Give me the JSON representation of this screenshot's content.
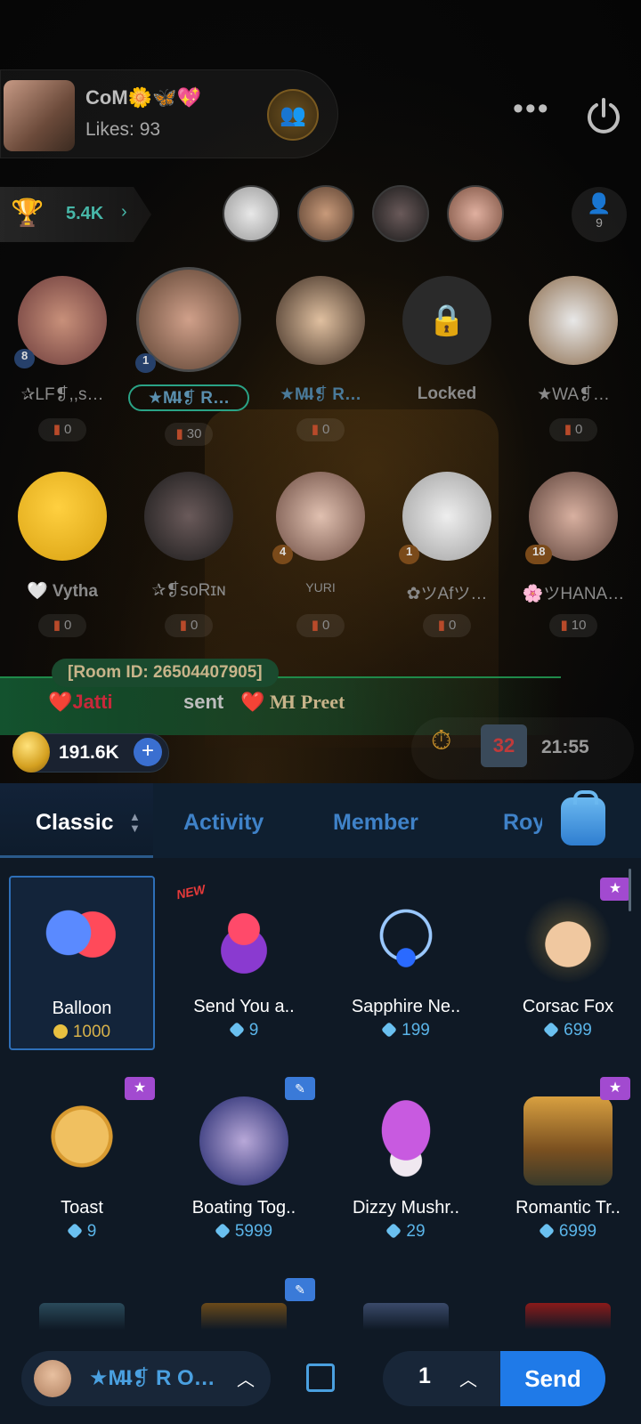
{
  "room": {
    "name": "CoM🌼🦋💖",
    "likes": "Likes: 93",
    "rank_value": "5.4K",
    "viewer_count": "9"
  },
  "seats": [
    {
      "name": "✰LF❡,,s…",
      "level": "8",
      "gift": "0"
    },
    {
      "name": "★M̶I❡ R…",
      "level": "1",
      "gift": "30"
    },
    {
      "name": "★M̶I❡ R…",
      "level": "",
      "gift": "0"
    },
    {
      "name": "Locked",
      "level": "",
      "gift": ""
    },
    {
      "name": "★WA❡…",
      "level": "",
      "gift": "0"
    },
    {
      "name": "🤍 Vytha",
      "level": "",
      "gift": "0"
    },
    {
      "name": "✰❡ꜱᴏRɪɴ",
      "level": "",
      "gift": "0"
    },
    {
      "name": "YURI",
      "level": "4",
      "gift": "0"
    },
    {
      "name": "✿ツAfツ…",
      "level": "1",
      "gift": "0"
    },
    {
      "name": "🌸ツHANA…",
      "level": "18",
      "gift": "10"
    }
  ],
  "chat": {
    "room_id": "[Room ID: 26504407905]",
    "sender": "❤️Jatti",
    "verb": "sent",
    "receiver": "❤️ M̶I Preet"
  },
  "balance": {
    "coins": "191.6K",
    "timer": "21:55",
    "calendar": "32"
  },
  "tabs": [
    "Classic",
    "Activity",
    "Member",
    "Roy"
  ],
  "gifts": [
    {
      "name": "Balloon",
      "price": "1000",
      "currency": "coin"
    },
    {
      "name": "Send You a..",
      "price": "9",
      "currency": "diamond"
    },
    {
      "name": "Sapphire Ne..",
      "price": "199",
      "currency": "diamond"
    },
    {
      "name": "Corsac Fox",
      "price": "699",
      "currency": "diamond"
    },
    {
      "name": "Toast",
      "price": "9",
      "currency": "diamond"
    },
    {
      "name": "Boating Tog..",
      "price": "5999",
      "currency": "diamond"
    },
    {
      "name": "Dizzy Mushr..",
      "price": "29",
      "currency": "diamond"
    },
    {
      "name": "Romantic Tr..",
      "price": "6999",
      "currency": "diamond"
    }
  ],
  "badge_new": "NEW",
  "bottom": {
    "receiver": "★M̶I❡ R O…",
    "quantity": "1",
    "send_label": "Send"
  }
}
